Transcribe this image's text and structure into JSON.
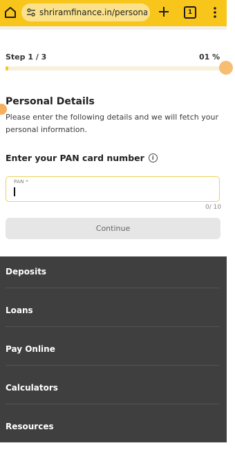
{
  "browser": {
    "url": "shriramfinance.in/personal-",
    "tab_count": "1"
  },
  "progress": {
    "step_text": "Step 1 / 3",
    "percent_text": "01 %",
    "fill_fraction": 0.01
  },
  "form": {
    "title": "Personal Details",
    "description": "Please enter the following details and we will fetch your personal information.",
    "pan_question": "Enter your PAN card number",
    "pan_label": "PAN *",
    "pan_value": "",
    "char_count": "0/ 10",
    "continue_label": "Continue"
  },
  "footer_nav": {
    "items": [
      {
        "label": "Deposits"
      },
      {
        "label": "Loans"
      },
      {
        "label": "Pay Online"
      },
      {
        "label": "Calculators"
      },
      {
        "label": "Resources"
      }
    ]
  },
  "colors": {
    "brand_yellow": "#f8c51b",
    "footer_bg": "#3f3f3f"
  }
}
